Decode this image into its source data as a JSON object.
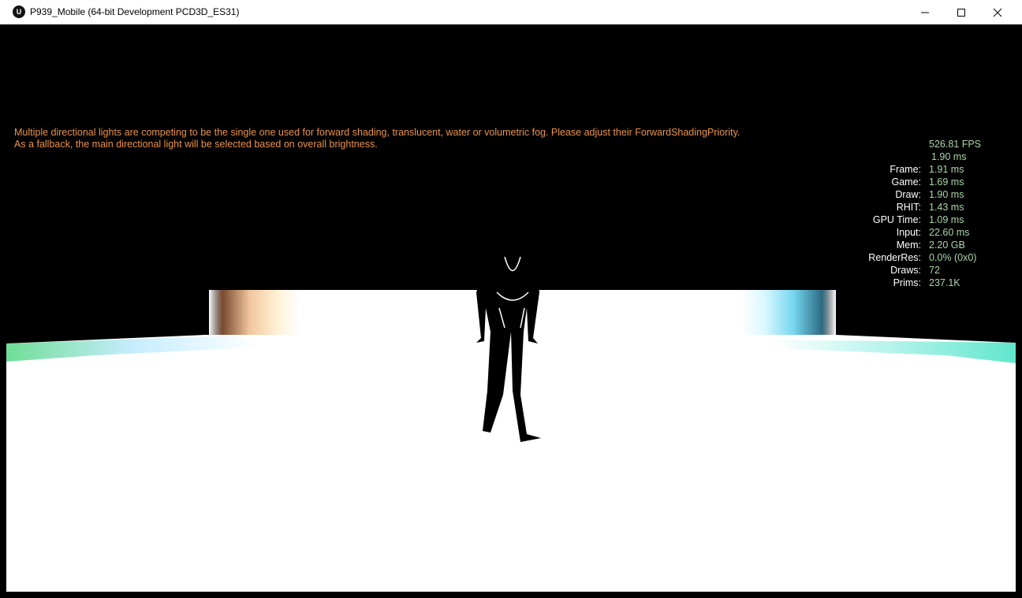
{
  "window": {
    "title": "P939_Mobile (64-bit Development PCD3D_ES31)",
    "logo_text": "U",
    "minimize_icon": "minimize-icon",
    "maximize_icon": "maximize-icon",
    "close_icon": "close-icon"
  },
  "warning": {
    "line1": "Multiple directional lights are competing to be the single one used for forward shading, translucent, water or volumetric fog. Please adjust their ForwardShadingPriority.",
    "line2": "As a fallback, the main directional light will be selected based on overall brightness."
  },
  "stats": {
    "fps": "526.81 FPS",
    "ms": "1.90 ms",
    "rows": [
      {
        "label": "Frame:",
        "value": "1.91 ms"
      },
      {
        "label": "Game:",
        "value": "1.69 ms"
      },
      {
        "label": "Draw:",
        "value": "1.90 ms"
      },
      {
        "label": "RHIT:",
        "value": "1.43 ms"
      },
      {
        "label": "GPU Time:",
        "value": "1.09 ms"
      },
      {
        "label": "Input:",
        "value": "22.60 ms"
      },
      {
        "label": "Mem:",
        "value": "2.20 GB"
      },
      {
        "label": "RenderRes:",
        "value": "0.0% (0x0)"
      },
      {
        "label": "Draws:",
        "value": "72"
      },
      {
        "label": "Prims:",
        "value": "237.1K"
      }
    ]
  },
  "colors": {
    "warning_text": "#e8934a",
    "stat_value": "#a9d6a9",
    "stat_label": "#ffffff",
    "viewport_bg": "#000000"
  }
}
